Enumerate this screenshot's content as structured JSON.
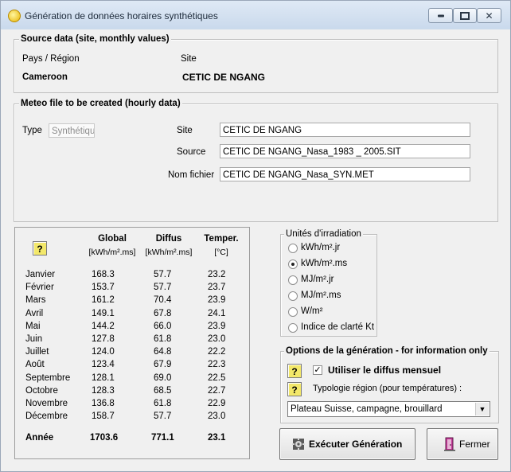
{
  "window": {
    "title": "Génération de données horaires synthétiques"
  },
  "source": {
    "group_title": "Source data  (site, monthly values)",
    "country_label": "Pays / Région",
    "site_label": "Site",
    "country": "Cameroon",
    "site": "CETIC DE NGANG"
  },
  "meteo": {
    "group_title": "Meteo file to be created (hourly data)",
    "type_label": "Type",
    "type_value": "Synthétique",
    "site_label": "Site",
    "site_value": "CETIC DE NGANG",
    "source_label": "Source",
    "source_value": "CETIC DE NGANG_Nasa_1983 _ 2005.SIT",
    "file_label": "Nom fichier",
    "file_value": "CETIC DE NGANG_Nasa_SYN.MET"
  },
  "table": {
    "help_glyph": "?",
    "headers": [
      {
        "title": "Global",
        "unit": "[kWh/m².ms]"
      },
      {
        "title": "Diffus",
        "unit": "[kWh/m².ms]"
      },
      {
        "title": "Temper.",
        "unit": "[°C]"
      }
    ],
    "rows": [
      {
        "month": "Janvier",
        "global": "168.3",
        "diffus": "57.7",
        "temp": "23.2"
      },
      {
        "month": "Février",
        "global": "153.7",
        "diffus": "57.7",
        "temp": "23.7"
      },
      {
        "month": "Mars",
        "global": "161.2",
        "diffus": "70.4",
        "temp": "23.9"
      },
      {
        "month": "Avril",
        "global": "149.1",
        "diffus": "67.8",
        "temp": "24.1"
      },
      {
        "month": "Mai",
        "global": "144.2",
        "diffus": "66.0",
        "temp": "23.9"
      },
      {
        "month": "Juin",
        "global": "127.8",
        "diffus": "61.8",
        "temp": "23.0"
      },
      {
        "month": "Juillet",
        "global": "124.0",
        "diffus": "64.8",
        "temp": "22.2"
      },
      {
        "month": "Août",
        "global": "123.4",
        "diffus": "67.9",
        "temp": "22.3"
      },
      {
        "month": "Septembre",
        "global": "128.1",
        "diffus": "69.0",
        "temp": "22.5"
      },
      {
        "month": "Octobre",
        "global": "128.3",
        "diffus": "68.5",
        "temp": "22.7"
      },
      {
        "month": "Novembre",
        "global": "136.8",
        "diffus": "61.8",
        "temp": "22.9"
      },
      {
        "month": "Décembre",
        "global": "158.7",
        "diffus": "57.7",
        "temp": "23.0"
      }
    ],
    "total": {
      "month": "Année",
      "global": "1703.6",
      "diffus": "771.1",
      "temp": "23.1"
    }
  },
  "units": {
    "group_title": "Unités d'irradiation",
    "options": [
      {
        "label": "kWh/m².jr",
        "checked": false
      },
      {
        "label": "kWh/m².ms",
        "checked": true
      },
      {
        "label": "MJ/m².jr",
        "checked": false
      },
      {
        "label": "MJ/m².ms",
        "checked": false
      },
      {
        "label": "W/m²",
        "checked": false
      },
      {
        "label": "Indice de clarté Kt",
        "checked": false
      }
    ]
  },
  "options": {
    "group_title": "Options de la génération - for information only",
    "help_glyph": "?",
    "use_diffuse_label": "Utiliser le diffus mensuel",
    "use_diffuse_checked": true,
    "check_glyph": "✓",
    "typology_label": "Typologie région (pour températures) :",
    "typology_value": "Plateau Suisse, campagne, brouillard"
  },
  "buttons": {
    "generate_label": "Exécuter Génération",
    "close_label": "Fermer"
  }
}
